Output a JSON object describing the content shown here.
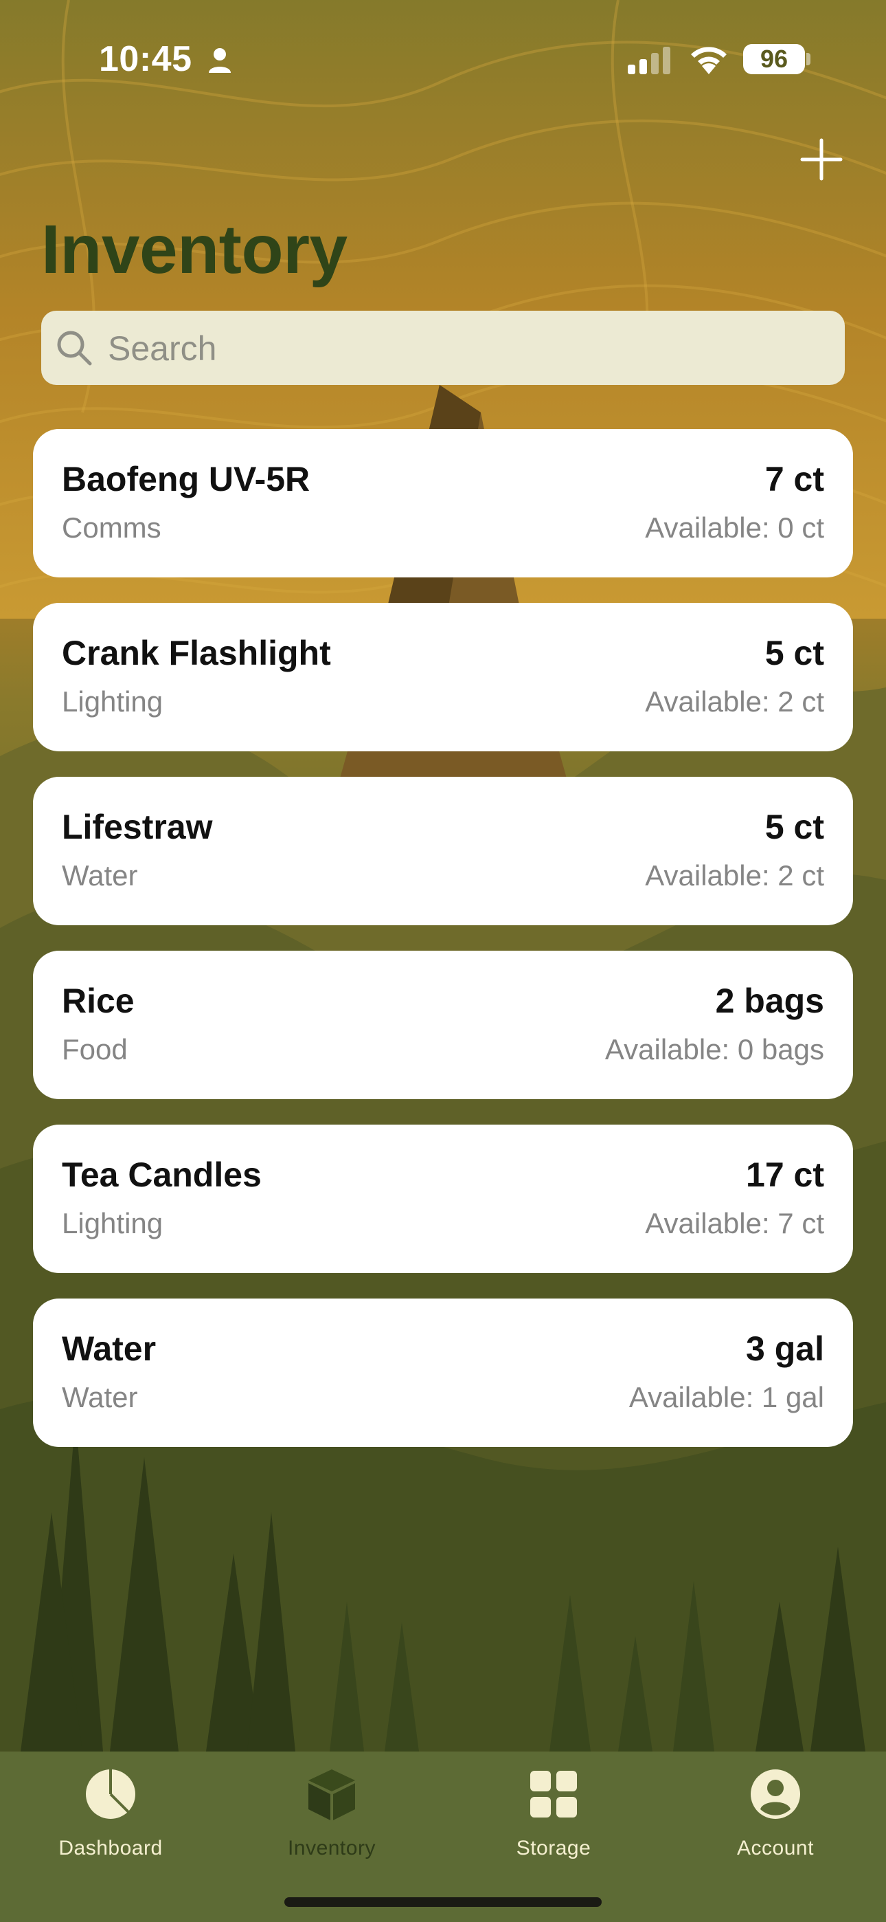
{
  "status_bar": {
    "time": "10:45",
    "battery": "96"
  },
  "header": {
    "title": "Inventory",
    "add_icon": "plus-icon"
  },
  "search": {
    "placeholder": "Search",
    "value": ""
  },
  "items": [
    {
      "name": "Baofeng UV-5R",
      "category": "Comms",
      "quantity": "7 ct",
      "available": "Available: 0 ct"
    },
    {
      "name": "Crank Flashlight",
      "category": "Lighting",
      "quantity": "5 ct",
      "available": "Available: 2 ct"
    },
    {
      "name": "Lifestraw",
      "category": "Water",
      "quantity": "5 ct",
      "available": "Available: 2 ct"
    },
    {
      "name": "Rice",
      "category": "Food",
      "quantity": "2 bags",
      "available": "Available: 0 bags"
    },
    {
      "name": "Tea Candles",
      "category": "Lighting",
      "quantity": "17 ct",
      "available": "Available: 7 ct"
    },
    {
      "name": "Water",
      "category": "Water",
      "quantity": "3 gal",
      "available": "Available: 1 gal"
    }
  ],
  "tab_bar": {
    "tabs": [
      {
        "label": "Dashboard",
        "icon": "pie-chart-icon",
        "selected": false
      },
      {
        "label": "Inventory",
        "icon": "box-icon",
        "selected": true
      },
      {
        "label": "Storage",
        "icon": "grid-icon",
        "selected": false
      },
      {
        "label": "Account",
        "icon": "person-circle-icon",
        "selected": false
      }
    ]
  },
  "colors": {
    "title": "#2f4418",
    "tab_bar": "#5d6b35",
    "tab_label": "#f4efcf",
    "tab_active": "#2e3b18",
    "card": "#ffffff",
    "search_bg": "#ecead3"
  }
}
